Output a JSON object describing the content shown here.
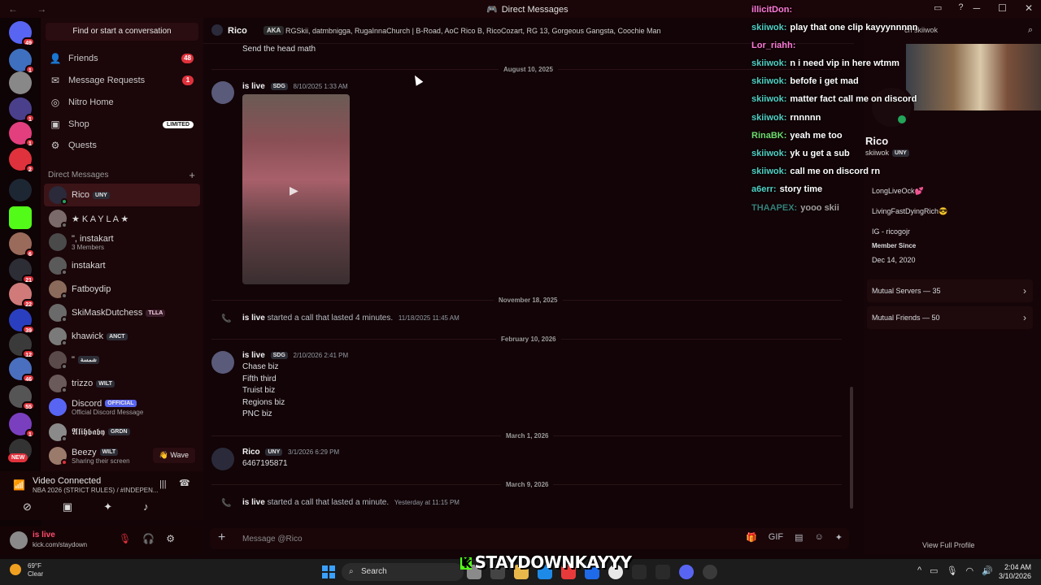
{
  "window": {
    "title": "Direct Messages"
  },
  "sidebar": {
    "find_placeholder": "Find or start a conversation",
    "nav": [
      {
        "label": "Friends",
        "badge": "48",
        "icon": "friends-icon"
      },
      {
        "label": "Message Requests",
        "badge": "1",
        "icon": "mail-icon"
      },
      {
        "label": "Nitro Home",
        "badge": "",
        "icon": "nitro-icon"
      },
      {
        "label": "Shop",
        "badge": "LIMITED",
        "icon": "shop-icon"
      },
      {
        "label": "Quests",
        "badge": "",
        "icon": "quests-icon"
      }
    ],
    "dm_header": "Direct Messages",
    "dms": [
      {
        "name": "Rico",
        "tag": "UNY",
        "sub": ""
      },
      {
        "name": "★ K A Y L A ★",
        "tag": "",
        "sub": ""
      },
      {
        "name": "\", instakart",
        "tag": "",
        "sub": "3 Members"
      },
      {
        "name": "instakart",
        "tag": "",
        "sub": ""
      },
      {
        "name": "Fatboydip",
        "tag": "",
        "sub": ""
      },
      {
        "name": "SkiMaskDutchess",
        "tag": "TLLA",
        "sub": ""
      },
      {
        "name": "khawick",
        "tag": "ANCT",
        "sub": ""
      },
      {
        "name": "\"",
        "tag": "شمسة",
        "sub": ""
      },
      {
        "name": "trizzo",
        "tag": "WILT",
        "sub": ""
      },
      {
        "name": "Discord",
        "tag": "OFFICIAL",
        "sub": "Official Discord Message"
      },
      {
        "name": "𝕬𝖑𝖎𝖍𝖇𝖆𝖇𝖞",
        "tag": "GRDN",
        "sub": ""
      },
      {
        "name": "Beezy",
        "tag": "WILT",
        "sub": "Sharing their screen"
      }
    ],
    "wave_label": "Wave"
  },
  "rail": {
    "badges": [
      "49",
      "1",
      "1",
      "1",
      "",
      "2",
      "",
      "",
      "6",
      "",
      "21",
      "22",
      "39",
      "12",
      "46",
      "55",
      "1",
      ""
    ],
    "new_label": "NEW"
  },
  "voice": {
    "title": "Video Connected",
    "subtitle": "NBA 2026 (STRICT RULES) / #INDEPEN..."
  },
  "user": {
    "name": "is live",
    "status": "kick.com/staydown"
  },
  "chat": {
    "header_name": "Rico",
    "aka_label": "AKA",
    "aka_names": "RGSkii, datmbnigga, RugaInnaChurch | B-Road, AoC Rico B, RicoCozart, RG 13, Gorgeous Gangsta, Coochie Man",
    "first_line": "Send the head math",
    "dates": [
      "August 10, 2025",
      "November 18, 2025",
      "February 10, 2026",
      "March 1, 2026",
      "March 9, 2026"
    ],
    "msg1": {
      "author": "is live",
      "tag": "SDG",
      "time": "8/10/2025 1:33 AM"
    },
    "call1": {
      "author": "is live",
      "text": "started a call that lasted 4 minutes.",
      "time": "11/18/2025 11:45 AM"
    },
    "msg2": {
      "author": "is live",
      "tag": "SDG",
      "time": "2/10/2026 2:41 PM",
      "lines": [
        "Chase biz",
        "Fifth third",
        "Truist biz",
        "Regions biz",
        "PNC biz"
      ]
    },
    "msg3": {
      "author": "Rico",
      "tag": "UNY",
      "time": "3/1/2026 6:29 PM",
      "text": "6467195871"
    },
    "call2": {
      "author": "is live",
      "text": "started a call that lasted a minute.",
      "time": "Yesterday at 11:15 PM"
    },
    "composer_placeholder": "Message @Rico"
  },
  "overlay": [
    {
      "user": "illicitDon:",
      "text": "",
      "color": "#ff7ad9"
    },
    {
      "user": "skiiwok:",
      "text": "play that one clip kayyynnnnn",
      "color": "#4fd1c5"
    },
    {
      "user": "Lor_riahh:",
      "text": "",
      "color": "#ff7ad9"
    },
    {
      "user": "skiiwok:",
      "text": "n i need vip in here wtmm",
      "color": "#4fd1c5"
    },
    {
      "user": "skiiwok:",
      "text": "befofe i get mad",
      "color": "#4fd1c5"
    },
    {
      "user": "skiiwok:",
      "text": "matter fact call me on discord",
      "color": "#4fd1c5"
    },
    {
      "user": "skiiwok:",
      "text": "rnnnnn",
      "color": "#4fd1c5"
    },
    {
      "user": "RinaBK:",
      "text": "yeah me too",
      "color": "#6fdc6f"
    },
    {
      "user": "skiiwok:",
      "text": "yk u get a sub",
      "color": "#4fd1c5"
    },
    {
      "user": "skiiwok:",
      "text": "call me on discord rn",
      "color": "#4fd1c5"
    },
    {
      "user": "a6err:",
      "text": "story time",
      "color": "#4fd1c5"
    },
    {
      "user": "THAAPEX:",
      "text": "yooo skii",
      "color": "#4fd1c5"
    }
  ],
  "profile": {
    "search_text": "ch skiiwok",
    "name": "Rico",
    "handle": "skiiwok",
    "tag": "UNY",
    "bio": [
      "LongLiveOck💕",
      "LivingFastDyingRich😎",
      "IG - ricogojr"
    ],
    "member_since_label": "Member Since",
    "member_since": "Dec 14, 2020",
    "mutual_servers": "Mutual Servers — 35",
    "mutual_friends": "Mutual Friends — 50",
    "view_full": "View Full Profile"
  },
  "taskbar": {
    "temp": "69°F",
    "weather": "Clear",
    "search": "Search",
    "time": "2:04 AM",
    "date": "3/10/2026"
  },
  "stream": {
    "brand": "STAYDOWNKAYYY"
  }
}
